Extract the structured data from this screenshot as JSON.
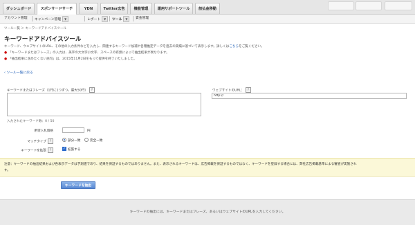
{
  "top_tabs": [
    {
      "label": "ダッシュボード",
      "active": false
    },
    {
      "label": "スポンサードサーチ",
      "active": true
    },
    {
      "label": "YDN",
      "active": false
    },
    {
      "label": "Twitter広告",
      "active": false
    },
    {
      "label": "機能管理",
      "active": false
    },
    {
      "label": "運用サポートツール",
      "active": false
    },
    {
      "label": "前払金移動",
      "active": false
    }
  ],
  "sub_nav": {
    "account": "アカウント管理",
    "campaign": "キャンペーン管理",
    "report": "レポート",
    "tools": "ツール",
    "budget": "資金管理"
  },
  "breadcrumb": "ツール一覧 ＞ キーワードアドバイスツール",
  "page_title": "キーワードアドバイスツール",
  "description": {
    "intro_pre": "キーワード、ウェブサイトのURL、その他の入力条件などを入力し、関連するキーワード候補や各種推定データを過去の実績に基づいて表示します。詳しくは",
    "intro_link": "こちら",
    "intro_post": "をご覧ください。",
    "bullet1": "「キーワードまたはフレーズ」の入力は、英字の大文字小文字、スペースの有無によって抽出結果が異なります。",
    "bullet2": "「抽出結果に含めたくない語句」は、2015年11月2日をもって提供を終了いたしました。"
  },
  "back_link": "ツール一覧に戻る",
  "form": {
    "keyword_label": "キーワードまたはフレーズ（1行に1つずつ。最大50行）",
    "url_label": "ウェブサイトのURL：",
    "url_value": "http://",
    "keyword_count": "入力されたキーワード数：0 / 50",
    "bid_label": "希望入札価格",
    "bid_unit": "円",
    "match_label": "マッチタイプ",
    "match_options": [
      {
        "label": "部分一致",
        "selected": true
      },
      {
        "label": "完全一致",
        "selected": false
      }
    ],
    "expand_label": "キーワードを拡張",
    "expand_option": "拡張する",
    "help_mark": "?"
  },
  "note": {
    "line1": "注意：キーワードの抽出結果および各表示データは予測値であり、結果を保証するものではありません。また、表示されるキーワードは、広告掲載を保証するものではなく、キーワードを登録する場合には、弊社広告掲載基準による審査が実施され",
    "line2": "す。"
  },
  "submit_label": "キーワードを抽出",
  "results_message": "キーワードの抽出には、キーワードまたはフレーズ、あるいはウェブサイトのURLを入力してください。"
}
